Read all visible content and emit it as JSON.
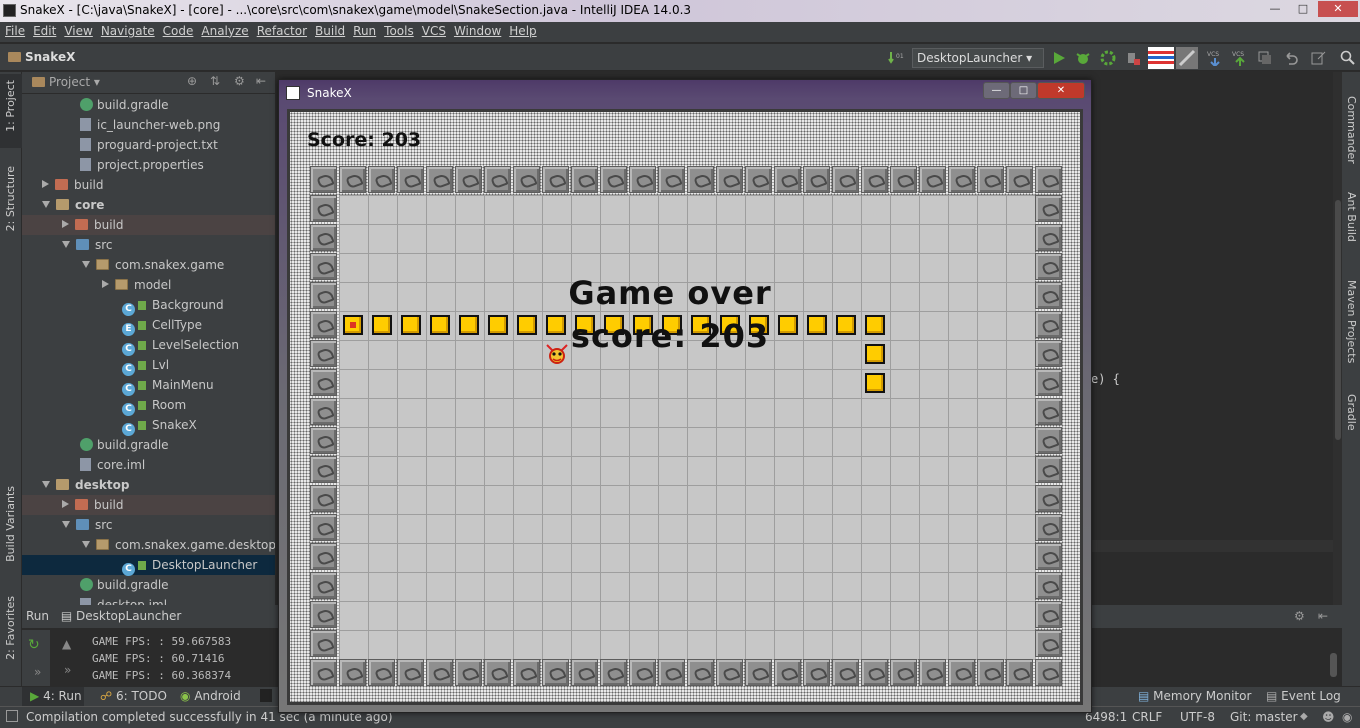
{
  "window": {
    "title": "SnakeX - [C:\\java\\SnakeX] - [core] - ...\\core\\src\\com\\snakex\\game\\model\\SnakeSection.java - IntelliJ IDEA 14.0.3"
  },
  "menu": [
    "File",
    "Edit",
    "View",
    "Navigate",
    "Code",
    "Analyze",
    "Refactor",
    "Build",
    "Run",
    "Tools",
    "VCS",
    "Window",
    "Help"
  ],
  "toolbar": {
    "project_name": "SnakeX",
    "run_config": "DesktopLauncher",
    "icons": [
      "make-icon",
      "run-icon",
      "debug-icon",
      "coverage-icon",
      "stop-icon",
      "vcs-update-icon",
      "vcs-commit-icon",
      "undo-icon",
      "settings-icon",
      "search-icon"
    ]
  },
  "left_strip": {
    "project": "1: Project",
    "structure": "2: Structure",
    "build_variants": "Build Variants",
    "favorites": "2: Favorites"
  },
  "right_strip": {
    "commander": "Commander",
    "ant": "Ant Build",
    "maven": "Maven Projects",
    "gradle": "Gradle"
  },
  "project_panel": {
    "header": "Project",
    "tree": [
      {
        "label": "build.gradle",
        "kind": "gradle"
      },
      {
        "label": "ic_launcher-web.png",
        "kind": "file"
      },
      {
        "label": "proguard-project.txt",
        "kind": "file"
      },
      {
        "label": "project.properties",
        "kind": "file"
      },
      {
        "label": "build",
        "kind": "folder"
      },
      {
        "label": "core",
        "kind": "folder"
      },
      {
        "label": "build",
        "kind": "folder"
      },
      {
        "label": "src",
        "kind": "folder"
      },
      {
        "label": "com.snakex.game",
        "kind": "package"
      },
      {
        "label": "model",
        "kind": "package"
      },
      {
        "label": "Background",
        "kind": "class",
        "badge": "C"
      },
      {
        "label": "CellType",
        "kind": "class",
        "badge": "E"
      },
      {
        "label": "LevelSelection",
        "kind": "class",
        "badge": "C"
      },
      {
        "label": "Lvl",
        "kind": "class",
        "badge": "C"
      },
      {
        "label": "MainMenu",
        "kind": "class",
        "badge": "C"
      },
      {
        "label": "Room",
        "kind": "class",
        "badge": "C"
      },
      {
        "label": "SnakeX",
        "kind": "class",
        "badge": "C"
      },
      {
        "label": "build.gradle",
        "kind": "gradle"
      },
      {
        "label": "core.iml",
        "kind": "file"
      },
      {
        "label": "desktop",
        "kind": "folder"
      },
      {
        "label": "build",
        "kind": "folder"
      },
      {
        "label": "src",
        "kind": "folder"
      },
      {
        "label": "com.snakex.game.desktop",
        "kind": "package"
      },
      {
        "label": "DesktopLauncher",
        "kind": "class",
        "badge": "C"
      },
      {
        "label": "build.gradle",
        "kind": "gradle"
      },
      {
        "label": "desktop.iml",
        "kind": "file"
      }
    ]
  },
  "editor": {
    "code_fragment": "e)  {"
  },
  "run_panel": {
    "tab": "Run",
    "config": "DesktopLauncher",
    "lines": [
      "GAME FPS: : 59.667583",
      "GAME FPS: : 60.71416",
      "GAME FPS: : 60.368374"
    ]
  },
  "bottom_tabs": {
    "run": "4: Run",
    "todo": "6: TODO",
    "android": "Android",
    "memory": "Memory Monitor",
    "event_log": "Event Log"
  },
  "status": {
    "message": "Compilation completed successfully in 41 sec (a minute ago)",
    "position": "6498:1",
    "line_sep": "CRLF",
    "encoding": "UTF-8",
    "git": "Git: master"
  },
  "game": {
    "title": "SnakeX",
    "score": "Score: 203",
    "game_over": "Game over",
    "final_score": "score: 203",
    "grid_cols": 26,
    "grid_rows": 18,
    "snake_cells": [
      [
        1,
        5
      ],
      [
        2,
        5
      ],
      [
        3,
        5
      ],
      [
        4,
        5
      ],
      [
        5,
        5
      ],
      [
        6,
        5
      ],
      [
        7,
        5
      ],
      [
        8,
        5
      ],
      [
        9,
        5
      ],
      [
        10,
        5
      ],
      [
        11,
        5
      ],
      [
        12,
        5
      ],
      [
        13,
        5
      ],
      [
        14,
        5
      ],
      [
        15,
        5
      ],
      [
        16,
        5
      ],
      [
        17,
        5
      ],
      [
        18,
        5
      ],
      [
        19,
        5
      ],
      [
        19,
        6
      ],
      [
        19,
        7
      ]
    ],
    "mouse_cell": [
      8,
      6
    ]
  }
}
